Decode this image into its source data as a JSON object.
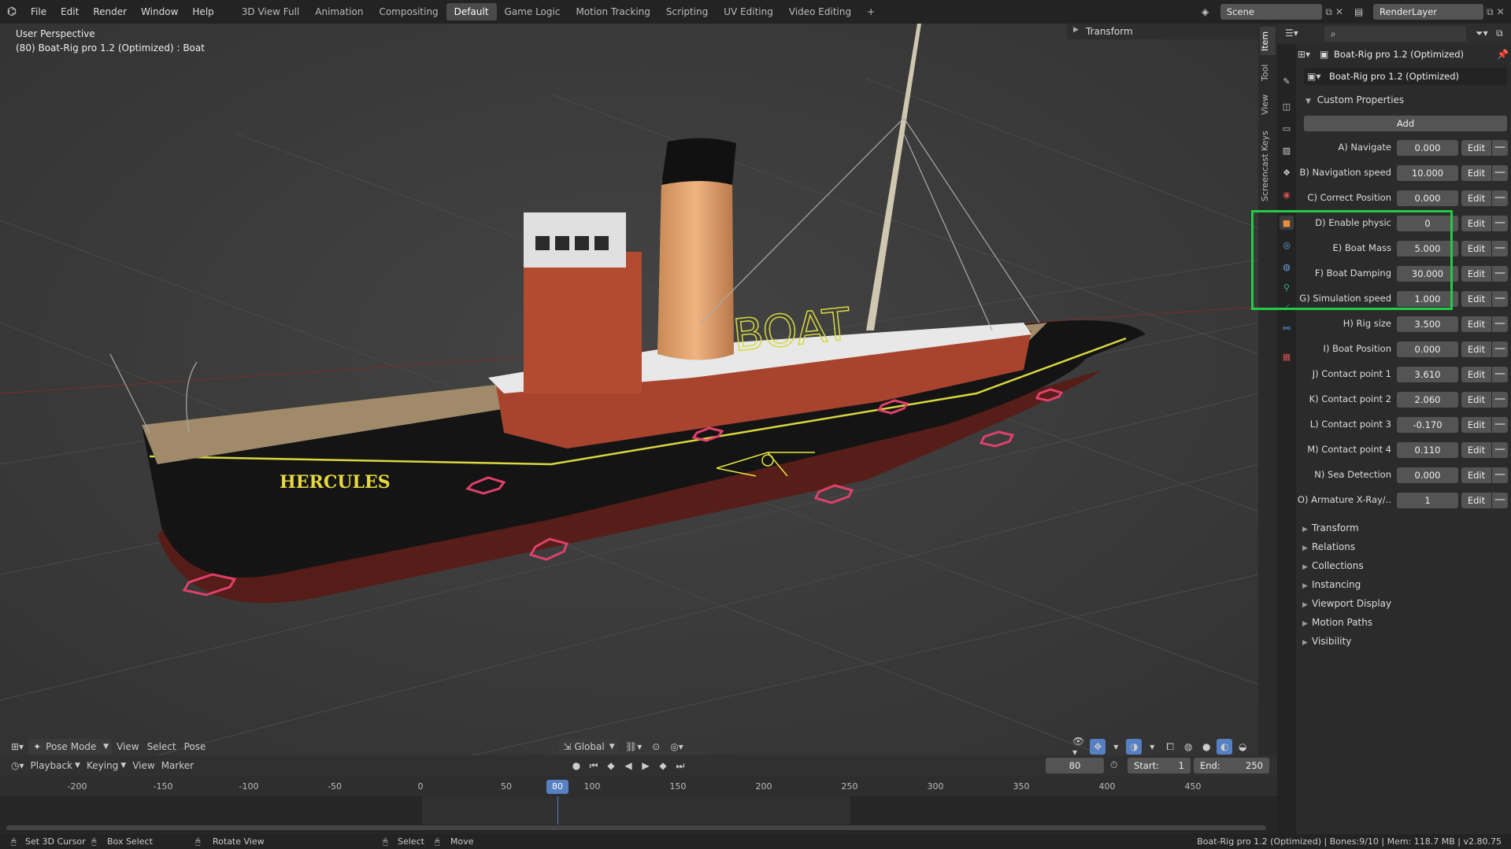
{
  "menu": [
    "File",
    "Edit",
    "Render",
    "Window",
    "Help"
  ],
  "workspaces": [
    "3D View Full",
    "Animation",
    "Compositing",
    "Default",
    "Game Logic",
    "Motion Tracking",
    "Scripting",
    "UV Editing",
    "Video Editing"
  ],
  "active_workspace": "Default",
  "add_workspace": "+",
  "scene": "Scene",
  "render_layer": "RenderLayer",
  "viewport": {
    "perspective": "User Perspective",
    "object_info": "(80) Boat-Rig pro 1.2 (Optimized) : Boat",
    "transform_panel": "Transform",
    "hull_name": "HERCULES",
    "rig_text": "BOAT"
  },
  "viewport_header": {
    "mode": "Pose Mode",
    "items": [
      "View",
      "Select",
      "Pose"
    ],
    "orientation": "Global"
  },
  "sidebar_tabs": [
    "Item",
    "Tool",
    "View",
    "Screencast Keys"
  ],
  "properties": {
    "object_name": "Boat-Rig pro 1.2 (Optimized)",
    "data_name": "Boat-Rig pro 1.2 (Optimized)",
    "custom_properties_title": "Custom Properties",
    "add_label": "Add",
    "edit_label": "Edit",
    "minus_label": "—",
    "rows": [
      {
        "label": "A) Navigate",
        "value": "0.000"
      },
      {
        "label": "B) Navigation speed",
        "value": "10.000"
      },
      {
        "label": "C) Correct Position",
        "value": "0.000"
      },
      {
        "label": "D) Enable physic",
        "value": "0"
      },
      {
        "label": "E) Boat Mass",
        "value": "5.000"
      },
      {
        "label": "F) Boat Damping",
        "value": "30.000"
      },
      {
        "label": "G) Simulation speed",
        "value": "1.000"
      },
      {
        "label": "H) Rig size",
        "value": "3.500"
      },
      {
        "label": "I) Boat Position",
        "value": "0.000"
      },
      {
        "label": "J) Contact point 1",
        "value": "3.610"
      },
      {
        "label": "K) Contact point 2",
        "value": "2.060"
      },
      {
        "label": "L) Contact point 3",
        "value": "-0.170"
      },
      {
        "label": "M) Contact point 4",
        "value": "0.110"
      },
      {
        "label": "N) Sea Detection",
        "value": "0.000"
      },
      {
        "label": "O) Armature X-Ray/..",
        "value": "1"
      }
    ],
    "sections": [
      "Transform",
      "Relations",
      "Collections",
      "Instancing",
      "Viewport Display",
      "Motion Paths",
      "Visibility"
    ]
  },
  "timeline": {
    "menus": [
      "Playback",
      "Keying",
      "View",
      "Marker"
    ],
    "current_frame": "80",
    "start_label": "Start:",
    "start": "1",
    "end_label": "End:",
    "end": "250",
    "ticks": [
      "-200",
      "-150",
      "-100",
      "-50",
      "0",
      "50",
      "100",
      "150",
      "200",
      "250",
      "300",
      "350",
      "400",
      "450"
    ]
  },
  "statusbar": {
    "set_cursor": "Set 3D Cursor",
    "box_select": "Box Select",
    "rotate_view": "Rotate View",
    "select": "Select",
    "move": "Move",
    "info": "Boat-Rig pro 1.2 (Optimized) | Bones:9/10 | Mem: 118.7 MB | v2.80.75"
  },
  "colors": {
    "highlight": "#22cc44",
    "accent": "#5680c2",
    "hull_red": "#a8432e"
  }
}
